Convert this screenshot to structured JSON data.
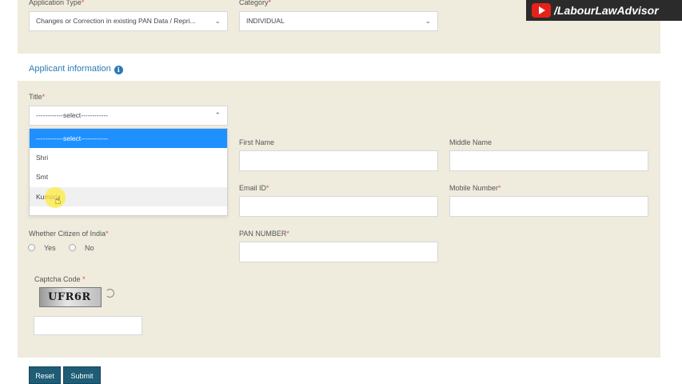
{
  "top": {
    "application_type_label": "Application Type",
    "application_type_value": "Changes or Correction in existing PAN Data / Repri...",
    "category_label": "Category",
    "category_value": "INDIVIDUAL"
  },
  "section": {
    "title": "Applicant information",
    "info_icon": "i"
  },
  "title_field": {
    "label": "Title",
    "value": "------------select------------",
    "options": [
      "------------select------------",
      "Shri",
      "Smt",
      "Kumari"
    ]
  },
  "fields": {
    "first_name": "First Name",
    "middle_name": "Middle Name",
    "email": "Email ID",
    "mobile": "Mobile Number",
    "citizen": "Whether Citizen of India",
    "citizen_yes": "Yes",
    "citizen_no": "No",
    "pan": "PAN NUMBER",
    "captcha": "Captcha Code",
    "captcha_text": "UFR6R"
  },
  "required_mark": "*",
  "buttons": {
    "reset": "Reset",
    "submit": "Submit"
  },
  "watermark": "/LabourLawAdvisor",
  "icons": {
    "chevron": "chevron-down-icon",
    "refresh": "refresh-icon",
    "info": "info-icon",
    "youtube": "youtube-icon"
  },
  "colors": {
    "panel_bg": "#efebdd",
    "accent_blue": "#2a7ab6",
    "selected_option": "#1e90ff",
    "button_bg": "#1f5c75",
    "required": "#d9534f"
  }
}
